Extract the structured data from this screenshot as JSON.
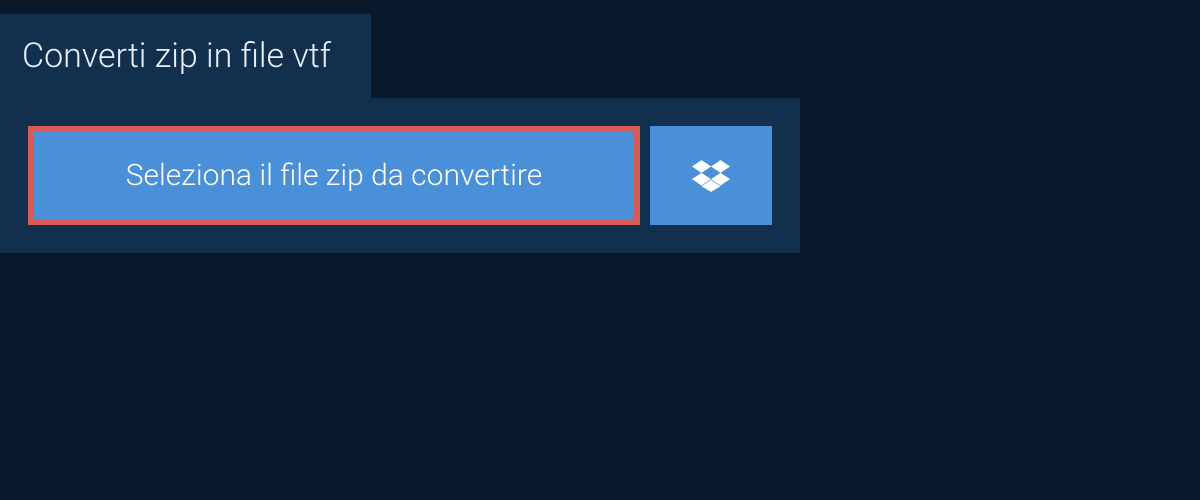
{
  "tab": {
    "label": "Converti zip in file vtf"
  },
  "panel": {
    "select_button_label": "Seleziona il file zip da convertire"
  }
}
